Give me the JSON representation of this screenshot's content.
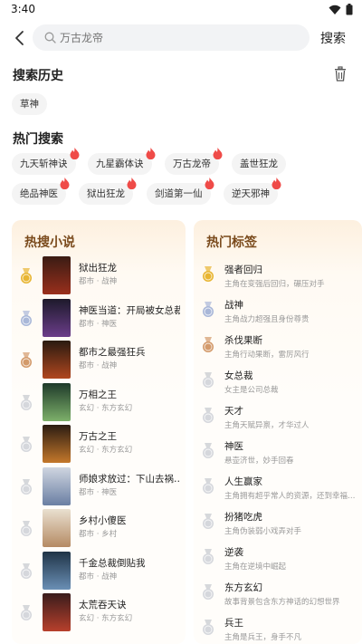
{
  "status": {
    "time": "3:40"
  },
  "search": {
    "placeholder": "万古龙帝",
    "button": "搜索"
  },
  "history": {
    "title": "搜索历史",
    "items": [
      "草神"
    ]
  },
  "hot_search": {
    "title": "热门搜索",
    "items": [
      "九天斩神诀",
      "九星霸体诀",
      "万古龙帝",
      "盖世狂龙",
      "绝品神医",
      "狱出狂龙",
      "剑道第一仙",
      "逆天邪神"
    ]
  },
  "hot_novels": {
    "title": "热搜小说",
    "items": [
      {
        "rank": 1,
        "title": "狱出狂龙",
        "meta": "都市 · 战神"
      },
      {
        "rank": 2,
        "title": "神医当道：开局被女总裁…",
        "meta": "都市 · 神医"
      },
      {
        "rank": 3,
        "title": "都市之最强狂兵",
        "meta": "都市 · 战神"
      },
      {
        "rank": 4,
        "title": "万相之王",
        "meta": "玄幻 · 东方玄幻"
      },
      {
        "rank": 5,
        "title": "万古之王",
        "meta": "玄幻 · 东方玄幻"
      },
      {
        "rank": 6,
        "title": "师娘求放过：下山去祸…",
        "meta": "都市 · 神医"
      },
      {
        "rank": 7,
        "title": "乡村小傻医",
        "meta": "都市 · 乡村"
      },
      {
        "rank": 8,
        "title": "千金总裁倒贴我",
        "meta": "都市 · 战神"
      },
      {
        "rank": 9,
        "title": "太荒吞天诀",
        "meta": "玄幻 · 东方玄幻"
      }
    ]
  },
  "hot_tags": {
    "title": "热门标签",
    "items": [
      {
        "rank": 1,
        "name": "强者回归",
        "desc": "主角在变强后回归，碾压对手"
      },
      {
        "rank": 2,
        "name": "战神",
        "desc": "主角战力超强且身份尊贵"
      },
      {
        "rank": 3,
        "name": "杀伐果断",
        "desc": "主角行动果断，雷厉风行"
      },
      {
        "rank": 4,
        "name": "女总裁",
        "desc": "女主是公司总裁"
      },
      {
        "rank": 5,
        "name": "天才",
        "desc": "主角天赋异禀，才华过人"
      },
      {
        "rank": 6,
        "name": "神医",
        "desc": "悬壶济世，妙手回春"
      },
      {
        "rank": 7,
        "name": "人生赢家",
        "desc": "主角拥有超乎常人的资源，还到幸福…"
      },
      {
        "rank": 8,
        "name": "扮猪吃虎",
        "desc": "主角伪装弱小戏弄对手"
      },
      {
        "rank": 9,
        "name": "逆袭",
        "desc": "主角在逆境中崛起"
      },
      {
        "rank": 10,
        "name": "东方玄幻",
        "desc": "故事背景包含东方神话的幻想世界"
      },
      {
        "rank": 11,
        "name": "兵王",
        "desc": "主角是兵王，身手不凡"
      }
    ]
  },
  "colors": {
    "gold": "#e8b532",
    "silver": "#a9b7d8",
    "bronze": "#d39a6b",
    "hot": "#ef4b48",
    "panel_title": "#7a4a1c"
  }
}
